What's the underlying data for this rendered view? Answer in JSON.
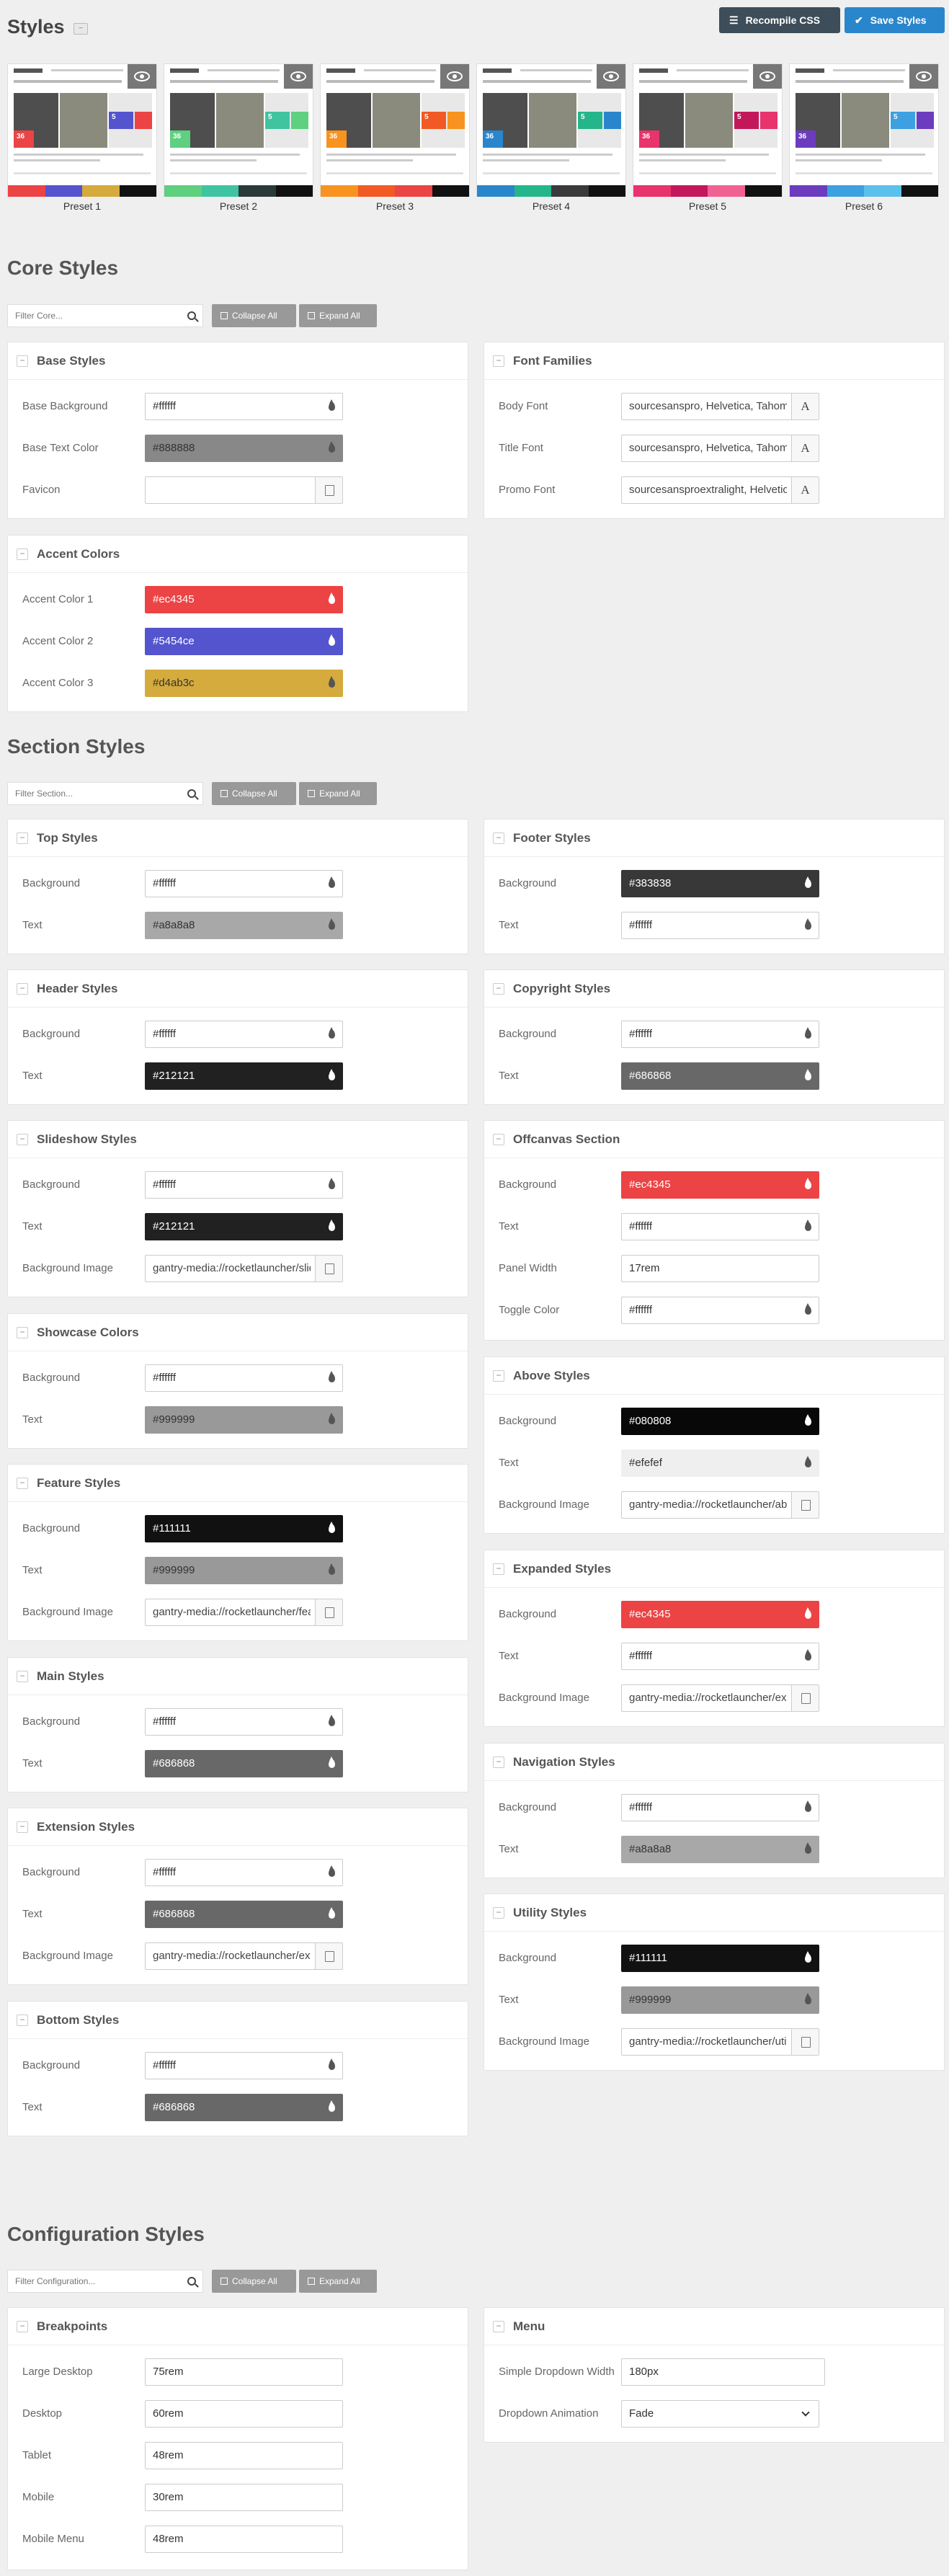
{
  "header": {
    "title": "Styles",
    "title_toggle": "−",
    "recompile_label": "Recompile CSS",
    "save_label": "Save Styles"
  },
  "presets": [
    {
      "label": "Preset 1",
      "colors": [
        "#ec4345",
        "#5454ce",
        "#d4ab3c",
        "#111111"
      ]
    },
    {
      "label": "Preset 2",
      "colors": [
        "#5fcf80",
        "#40c4a0",
        "#2a3a3a",
        "#111111"
      ]
    },
    {
      "label": "Preset 3",
      "colors": [
        "#f7931e",
        "#f15a24",
        "#ec4345",
        "#111111"
      ]
    },
    {
      "label": "Preset 4",
      "colors": [
        "#2a86cc",
        "#24b68a",
        "#3a3a3a",
        "#111111"
      ]
    },
    {
      "label": "Preset 5",
      "colors": [
        "#e8336d",
        "#c2185b",
        "#f06292",
        "#111111"
      ]
    },
    {
      "label": "Preset 6",
      "colors": [
        "#6c3cbf",
        "#3da0e0",
        "#5bc0eb",
        "#111111"
      ]
    }
  ],
  "preset_numbers": [
    "36",
    "5"
  ],
  "core": {
    "title": "Core Styles",
    "filter_placeholder": "Filter Core...",
    "collapse_label": "Collapse All",
    "expand_label": "Expand All",
    "base": {
      "title": "Base Styles",
      "rows": [
        {
          "label": "Base Background",
          "value": "#ffffff",
          "bg": "#ffffff",
          "tone": "light"
        },
        {
          "label": "Base Text Color",
          "value": "#888888",
          "bg": "#888888",
          "tone": "light"
        },
        {
          "label": "Favicon",
          "value": ""
        }
      ]
    },
    "fonts": {
      "title": "Font Families",
      "rows": [
        {
          "label": "Body Font",
          "value": "sourcesanspro, Helvetica, Tahoma, Geneva, Arial, sans-serif"
        },
        {
          "label": "Title Font",
          "value": "sourcesanspro, Helvetica, Tahoma, Geneva, Arial, sans-serif"
        },
        {
          "label": "Promo Font",
          "value": "sourcesansproextralight, Helvetica, Tahoma, Geneva, Arial, sans-serif"
        }
      ],
      "font_button": "A"
    },
    "accent": {
      "title": "Accent Colors",
      "rows": [
        {
          "label": "Accent Color 1",
          "value": "#ec4345",
          "bg": "#ec4345",
          "tone": "dark"
        },
        {
          "label": "Accent Color 2",
          "value": "#5454ce",
          "bg": "#5454ce",
          "tone": "dark"
        },
        {
          "label": "Accent Color 3",
          "value": "#d4ab3c",
          "bg": "#d4ab3c",
          "tone": "light"
        }
      ]
    }
  },
  "section": {
    "title": "Section Styles",
    "filter_placeholder": "Filter Section...",
    "collapse_label": "Collapse All",
    "expand_label": "Expand All",
    "top": {
      "title": "Top Styles",
      "rows": [
        {
          "label": "Background",
          "value": "#ffffff",
          "bg": "#ffffff",
          "tone": "light"
        },
        {
          "label": "Text",
          "value": "#a8a8a8",
          "bg": "#a8a8a8",
          "tone": "light"
        }
      ]
    },
    "footer": {
      "title": "Footer Styles",
      "rows": [
        {
          "label": "Background",
          "value": "#383838",
          "bg": "#383838",
          "tone": "dark"
        },
        {
          "label": "Text",
          "value": "#ffffff",
          "bg": "#ffffff",
          "tone": "light"
        }
      ]
    },
    "header": {
      "title": "Header Styles",
      "rows": [
        {
          "label": "Background",
          "value": "#ffffff",
          "bg": "#ffffff",
          "tone": "light"
        },
        {
          "label": "Text",
          "value": "#212121",
          "bg": "#212121",
          "tone": "dark"
        }
      ]
    },
    "copyright": {
      "title": "Copyright Styles",
      "rows": [
        {
          "label": "Background",
          "value": "#ffffff",
          "bg": "#ffffff",
          "tone": "light"
        },
        {
          "label": "Text",
          "value": "#686868",
          "bg": "#686868",
          "tone": "dark"
        }
      ]
    },
    "slideshow": {
      "title": "Slideshow Styles",
      "rows": [
        {
          "label": "Background",
          "value": "#ffffff",
          "bg": "#ffffff",
          "tone": "light"
        },
        {
          "label": "Text",
          "value": "#212121",
          "bg": "#212121",
          "tone": "dark"
        },
        {
          "label": "Background Image",
          "value": "gantry-media://rocketlauncher/slideshow/bg.jpg"
        }
      ]
    },
    "offcanvas": {
      "title": "Offcanvas Section",
      "rows": [
        {
          "label": "Background",
          "value": "#ec4345",
          "bg": "#ec4345",
          "tone": "dark"
        },
        {
          "label": "Text",
          "value": "#ffffff",
          "bg": "#ffffff",
          "tone": "light"
        },
        {
          "label": "Panel Width",
          "value": "17rem"
        },
        {
          "label": "Toggle Color",
          "value": "#ffffff",
          "bg": "#ffffff",
          "tone": "light"
        }
      ]
    },
    "showcase": {
      "title": "Showcase Colors",
      "rows": [
        {
          "label": "Background",
          "value": "#ffffff",
          "bg": "#ffffff",
          "tone": "light"
        },
        {
          "label": "Text",
          "value": "#999999",
          "bg": "#999999",
          "tone": "light"
        }
      ]
    },
    "above": {
      "title": "Above Styles",
      "rows": [
        {
          "label": "Background",
          "value": "#080808",
          "bg": "#080808",
          "tone": "dark"
        },
        {
          "label": "Text",
          "value": "#efefef",
          "bg": "#efefef",
          "tone": "light"
        },
        {
          "label": "Background Image",
          "value": "gantry-media://rocketlauncher/above/bg.jpg"
        }
      ]
    },
    "feature": {
      "title": "Feature Styles",
      "rows": [
        {
          "label": "Background",
          "value": "#111111",
          "bg": "#111111",
          "tone": "dark"
        },
        {
          "label": "Text",
          "value": "#999999",
          "bg": "#999999",
          "tone": "light"
        },
        {
          "label": "Background Image",
          "value": "gantry-media://rocketlauncher/feature/bg.jpg"
        }
      ]
    },
    "expanded": {
      "title": "Expanded Styles",
      "rows": [
        {
          "label": "Background",
          "value": "#ec4345",
          "bg": "#ec4345",
          "tone": "dark"
        },
        {
          "label": "Text",
          "value": "#ffffff",
          "bg": "#ffffff",
          "tone": "light"
        },
        {
          "label": "Background Image",
          "value": "gantry-media://rocketlauncher/expanded/bg.jpg"
        }
      ]
    },
    "main": {
      "title": "Main Styles",
      "rows": [
        {
          "label": "Background",
          "value": "#ffffff",
          "bg": "#ffffff",
          "tone": "light"
        },
        {
          "label": "Text",
          "value": "#686868",
          "bg": "#686868",
          "tone": "dark"
        }
      ]
    },
    "navigation": {
      "title": "Navigation Styles",
      "rows": [
        {
          "label": "Background",
          "value": "#ffffff",
          "bg": "#ffffff",
          "tone": "light"
        },
        {
          "label": "Text",
          "value": "#a8a8a8",
          "bg": "#a8a8a8",
          "tone": "light"
        }
      ]
    },
    "extension": {
      "title": "Extension Styles",
      "rows": [
        {
          "label": "Background",
          "value": "#ffffff",
          "bg": "#ffffff",
          "tone": "light"
        },
        {
          "label": "Text",
          "value": "#686868",
          "bg": "#686868",
          "tone": "dark"
        },
        {
          "label": "Background Image",
          "value": "gantry-media://rocketlauncher/extension/bg.jpg"
        }
      ]
    },
    "utility": {
      "title": "Utility Styles",
      "rows": [
        {
          "label": "Background",
          "value": "#111111",
          "bg": "#111111",
          "tone": "dark"
        },
        {
          "label": "Text",
          "value": "#999999",
          "bg": "#999999",
          "tone": "light"
        },
        {
          "label": "Background Image",
          "value": "gantry-media://rocketlauncher/utility/bg.jpg"
        }
      ]
    },
    "bottom": {
      "title": "Bottom Styles",
      "rows": [
        {
          "label": "Background",
          "value": "#ffffff",
          "bg": "#ffffff",
          "tone": "light"
        },
        {
          "label": "Text",
          "value": "#686868",
          "bg": "#686868",
          "tone": "dark"
        }
      ]
    }
  },
  "configuration": {
    "title": "Configuration Styles",
    "filter_placeholder": "Filter Configuration...",
    "collapse_label": "Collapse All",
    "expand_label": "Expand All",
    "breakpoints": {
      "title": "Breakpoints",
      "rows": [
        {
          "label": "Large Desktop",
          "value": "75rem"
        },
        {
          "label": "Desktop",
          "value": "60rem"
        },
        {
          "label": "Tablet",
          "value": "48rem"
        },
        {
          "label": "Mobile",
          "value": "30rem"
        },
        {
          "label": "Mobile Menu",
          "value": "48rem"
        }
      ]
    },
    "menu": {
      "title": "Menu",
      "rows": [
        {
          "label": "Simple Dropdown Width",
          "value": "180px"
        },
        {
          "label": "Dropdown Animation",
          "value": "Fade"
        }
      ]
    }
  }
}
